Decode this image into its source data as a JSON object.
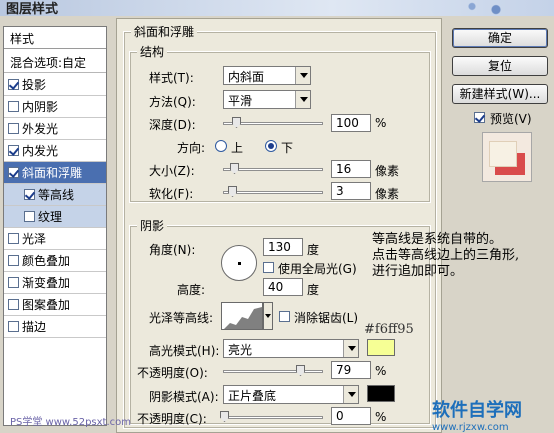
{
  "window": {
    "title": "图层样式"
  },
  "left_panel": {
    "header": "样式",
    "blend_label": "混合选项:自定",
    "items": [
      {
        "label": "投影",
        "checked": true
      },
      {
        "label": "内阴影",
        "checked": false
      },
      {
        "label": "外发光",
        "checked": false
      },
      {
        "label": "内发光",
        "checked": true
      },
      {
        "label": "斜面和浮雕",
        "checked": true
      },
      {
        "label": "等高线",
        "checked": true
      },
      {
        "label": "纹理",
        "checked": false
      },
      {
        "label": "光泽",
        "checked": false
      },
      {
        "label": "颜色叠加",
        "checked": false
      },
      {
        "label": "渐变叠加",
        "checked": false
      },
      {
        "label": "图案叠加",
        "checked": false
      },
      {
        "label": "描边",
        "checked": false
      }
    ]
  },
  "bevel": {
    "group_title": "斜面和浮雕",
    "structure_title": "结构",
    "style_label": "样式(T):",
    "style_value": "内斜面",
    "technique_label": "方法(Q):",
    "technique_value": "平滑",
    "depth_label": "深度(D):",
    "depth_value": "100",
    "depth_unit": "%",
    "direction_label": "方向:",
    "up_label": "上",
    "down_label": "下",
    "size_label": "大小(Z):",
    "size_value": "16",
    "size_unit": "像素",
    "soften_label": "软化(F):",
    "soften_value": "3",
    "soften_unit": "像素"
  },
  "shading": {
    "title": "阴影",
    "angle_label": "角度(N):",
    "angle_value": "130",
    "angle_unit": "度",
    "global_light_label": "使用全局光(G)",
    "altitude_label": "高度:",
    "altitude_value": "40",
    "altitude_unit": "度",
    "gloss_label": "光泽等高线:",
    "antialias_label": "消除锯齿(L)",
    "highlight_label": "高光模式(H):",
    "highlight_value": "亮光",
    "highlight_color": "#f6ff95",
    "highlight_opacity_label": "不透明度(O):",
    "highlight_opacity_value": "79",
    "shadow_label": "阴影模式(A):",
    "shadow_value": "正片叠底",
    "shadow_color": "#000000",
    "shadow_opacity_label": "不透明度(C):",
    "shadow_opacity_value": "0",
    "pct": "%"
  },
  "annotations": {
    "hex": "#f6ff95",
    "note_line1": "等高线是系统自带的。",
    "note_line2": "点击等高线边上的三角形,",
    "note_line3": "进行追加即可。"
  },
  "buttons": {
    "ok": "确定",
    "reset": "复位",
    "new_style": "新建样式(W)...",
    "preview_label": "预览(V)"
  },
  "watermarks": {
    "left": "PS学堂 www.52psxt.com",
    "right": "软件自学网",
    "right_url": "www.rjzxw.com"
  }
}
